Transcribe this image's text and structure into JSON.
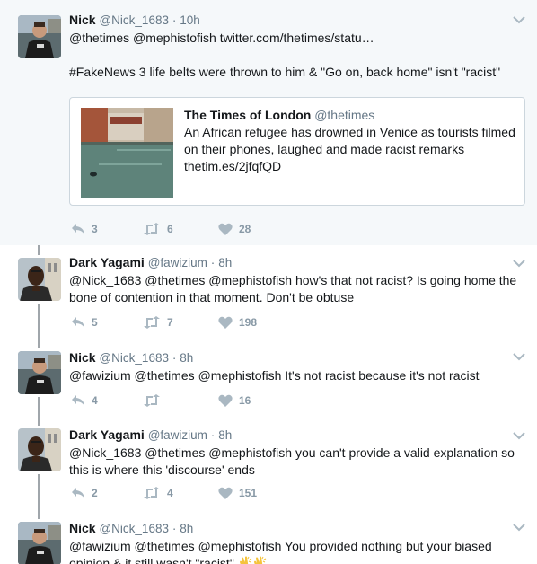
{
  "tweets": [
    {
      "fullname": "Nick",
      "username": "@Nick_1683",
      "dot": "·",
      "time": "10h",
      "text": "@thetimes @mephistofish twitter.com/thetimes/statu…\n\n#FakeNews 3 life belts were thrown to him & \"Go on, back home\" isn't \"racist\"",
      "card": {
        "title": "The Times of London",
        "handle": "@thetimes",
        "description": "An African refugee has drowned in Venice as tourists filmed on their phones, laughed and made racist remarks",
        "link": "thetim.es/2jfqfQD"
      },
      "replies": "3",
      "retweets": "6",
      "likes": "28"
    },
    {
      "fullname": "Dark Yagami",
      "username": "@fawizium",
      "dot": "·",
      "time": "8h",
      "text": "@Nick_1683 @thetimes @mephistofish how's that not racist? Is going home the bone of contention in that moment. Don't be obtuse",
      "replies": "5",
      "retweets": "7",
      "likes": "198"
    },
    {
      "fullname": "Nick",
      "username": "@Nick_1683",
      "dot": "·",
      "time": "8h",
      "text": "@fawizium @thetimes @mephistofish It's not racist because it's not racist",
      "replies": "4",
      "retweets": "",
      "likes": "16"
    },
    {
      "fullname": "Dark Yagami",
      "username": "@fawizium",
      "dot": "·",
      "time": "8h",
      "text": "@Nick_1683 @thetimes @mephistofish you can't provide a valid explanation so this is where this 'discourse' ends",
      "replies": "2",
      "retweets": "4",
      "likes": "151"
    },
    {
      "fullname": "Nick",
      "username": "@Nick_1683",
      "dot": "·",
      "time": "8h",
      "text": "@fawizium @thetimes @mephistofish You provided nothing but your biased opinion & it still wasn't \"racist\"",
      "replies": "",
      "retweets": "",
      "likes": ""
    }
  ],
  "icons": {
    "reply": "reply-icon",
    "retweet": "retweet-icon",
    "like": "heart-icon",
    "caret": "chevron-down-icon",
    "clap": "clapping-hands-emoji"
  },
  "colors": {
    "text": "#14171a",
    "muted": "#657786",
    "action": "#8899a6",
    "highlight_bg": "#f5f8fa",
    "thread_line": "#a0a6ab",
    "border": "#ccd6dd"
  }
}
